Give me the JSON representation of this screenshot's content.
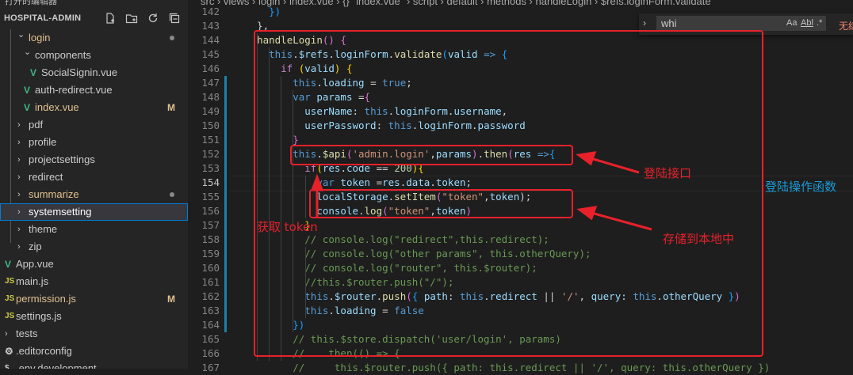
{
  "sidebar": {
    "cut_top_label": "打开的编辑器",
    "title": "HOSPITAL-ADMIN",
    "actions": [
      "new-file-icon",
      "new-folder-icon",
      "refresh-icon",
      "collapse-all-icon"
    ],
    "items": [
      {
        "label": "login",
        "kind": "folder-open",
        "depth": 1,
        "color": "#e2c08d",
        "status": "dot"
      },
      {
        "label": "components",
        "kind": "folder-open",
        "depth": 2,
        "color": "#cccccc",
        "status": ""
      },
      {
        "label": "SocialSignin.vue",
        "kind": "vue",
        "depth": 3,
        "color": "#cccccc",
        "status": ""
      },
      {
        "label": "auth-redirect.vue",
        "kind": "vue",
        "depth": 2,
        "color": "#cccccc",
        "status": ""
      },
      {
        "label": "index.vue",
        "kind": "vue",
        "depth": 2,
        "color": "#e2c08d",
        "status": "M"
      },
      {
        "label": "pdf",
        "kind": "folder",
        "depth": 1,
        "color": "#cccccc",
        "status": ""
      },
      {
        "label": "profile",
        "kind": "folder",
        "depth": 1,
        "color": "#cccccc",
        "status": ""
      },
      {
        "label": "projectsettings",
        "kind": "folder",
        "depth": 1,
        "color": "#cccccc",
        "status": ""
      },
      {
        "label": "redirect",
        "kind": "folder",
        "depth": 1,
        "color": "#cccccc",
        "status": ""
      },
      {
        "label": "summarize",
        "kind": "folder",
        "depth": 1,
        "color": "#e2c08d",
        "status": "dot"
      },
      {
        "label": "systemsetting",
        "kind": "folder",
        "depth": 1,
        "color": "#ffffff",
        "status": "",
        "selected": true
      },
      {
        "label": "theme",
        "kind": "folder",
        "depth": 1,
        "color": "#cccccc",
        "status": ""
      },
      {
        "label": "zip",
        "kind": "folder",
        "depth": 1,
        "color": "#cccccc",
        "status": ""
      },
      {
        "label": "App.vue",
        "kind": "vue",
        "depth": 0,
        "color": "#cccccc",
        "status": ""
      },
      {
        "label": "main.js",
        "kind": "js",
        "depth": 0,
        "color": "#cccccc",
        "status": ""
      },
      {
        "label": "permission.js",
        "kind": "js",
        "depth": 0,
        "color": "#e2c08d",
        "status": "M"
      },
      {
        "label": "settings.js",
        "kind": "js",
        "depth": 0,
        "color": "#cccccc",
        "status": ""
      },
      {
        "label": "tests",
        "kind": "folder",
        "depth": -1,
        "color": "#cccccc",
        "status": ""
      },
      {
        "label": ".editorconfig",
        "kind": "gear",
        "depth": -1,
        "color": "#cccccc",
        "status": ""
      },
      {
        "label": ".env.development",
        "kind": "env",
        "depth": -1,
        "color": "#cccccc",
        "status": ""
      }
    ]
  },
  "editor": {
    "breadcrumb": "src  ›  views  ›  login  ›  index.vue  ›  {} \"index.vue\"  ›  script  ›  default  ›  methods  ›  handleLogin  ›  $refs.loginForm.validate",
    "find": {
      "value": "whi",
      "opt_case": "Aa",
      "opt_word": "Abl",
      "opt_regex": ".*",
      "result": "无结果"
    },
    "current_line": 154,
    "lines": [
      {
        "n": 142,
        "toks": [
          [
            "    ",
            ""
          ],
          [
            "})",
            "t-br3"
          ]
        ]
      },
      {
        "n": 143,
        "toks": [
          [
            "  },",
            "t-op"
          ]
        ]
      },
      {
        "n": 144,
        "toks": [
          [
            "  ",
            ""
          ],
          [
            "handleLogin",
            "t-fn"
          ],
          [
            "() ",
            "t-br2"
          ],
          [
            "{",
            "t-br2"
          ]
        ]
      },
      {
        "n": 145,
        "toks": [
          [
            "    ",
            ""
          ],
          [
            "this",
            "t-kw"
          ],
          [
            ".",
            "t-op"
          ],
          [
            "$refs",
            "t-var"
          ],
          [
            ".",
            "t-op"
          ],
          [
            "loginForm",
            "t-var"
          ],
          [
            ".",
            "t-op"
          ],
          [
            "validate",
            "t-fn"
          ],
          [
            "(",
            "t-br3"
          ],
          [
            "valid",
            "t-var"
          ],
          [
            " => ",
            "t-kw"
          ],
          [
            "{",
            "t-br3"
          ]
        ]
      },
      {
        "n": 146,
        "toks": [
          [
            "      ",
            ""
          ],
          [
            "if",
            "t-ctrl"
          ],
          [
            " (",
            "t-br1"
          ],
          [
            "valid",
            "t-var"
          ],
          [
            ") ",
            "t-br1"
          ],
          [
            "{",
            "t-br1"
          ]
        ]
      },
      {
        "n": 147,
        "toks": [
          [
            "        ",
            ""
          ],
          [
            "this",
            "t-kw"
          ],
          [
            ".",
            "t-op"
          ],
          [
            "loading",
            "t-var"
          ],
          [
            " = ",
            "t-op"
          ],
          [
            "true",
            "t-kw"
          ],
          [
            ";",
            "t-op"
          ]
        ]
      },
      {
        "n": 148,
        "toks": [
          [
            "        ",
            ""
          ],
          [
            "var",
            "t-kw"
          ],
          [
            " ",
            ""
          ],
          [
            "params",
            "t-var"
          ],
          [
            " =",
            "t-op"
          ],
          [
            "{",
            "t-br2"
          ]
        ]
      },
      {
        "n": 149,
        "toks": [
          [
            "          ",
            ""
          ],
          [
            "userName",
            "t-var"
          ],
          [
            ": ",
            "t-op"
          ],
          [
            "this",
            "t-kw"
          ],
          [
            ".",
            "t-op"
          ],
          [
            "loginForm",
            "t-var"
          ],
          [
            ".",
            "t-op"
          ],
          [
            "username",
            "t-var"
          ],
          [
            ",",
            "t-op"
          ]
        ]
      },
      {
        "n": 150,
        "toks": [
          [
            "          ",
            ""
          ],
          [
            "userPassword",
            "t-var"
          ],
          [
            ": ",
            "t-op"
          ],
          [
            "this",
            "t-kw"
          ],
          [
            ".",
            "t-op"
          ],
          [
            "loginForm",
            "t-var"
          ],
          [
            ".",
            "t-op"
          ],
          [
            "password",
            "t-var"
          ]
        ]
      },
      {
        "n": 151,
        "toks": [
          [
            "        ",
            ""
          ],
          [
            "}",
            "t-br2"
          ]
        ]
      },
      {
        "n": 152,
        "toks": [
          [
            "        ",
            ""
          ],
          [
            "this",
            "t-kw"
          ],
          [
            ".",
            "t-op"
          ],
          [
            "$api",
            "t-fn"
          ],
          [
            "(",
            "t-br2"
          ],
          [
            "'admin.login'",
            "t-str"
          ],
          [
            ",",
            "t-op"
          ],
          [
            "params",
            "t-var"
          ],
          [
            ")",
            "t-br2"
          ],
          [
            ".",
            "t-op"
          ],
          [
            "then",
            "t-fn"
          ],
          [
            "(",
            "t-br2"
          ],
          [
            "res",
            "t-var"
          ],
          [
            " =>",
            "t-kw"
          ],
          [
            "{",
            "t-br3"
          ]
        ]
      },
      {
        "n": 153,
        "toks": [
          [
            "          ",
            ""
          ],
          [
            "if",
            "t-ctrl"
          ],
          [
            "(",
            "t-br1"
          ],
          [
            "res",
            "t-var"
          ],
          [
            ".",
            "t-op"
          ],
          [
            "code",
            "t-var"
          ],
          [
            " == ",
            "t-op"
          ],
          [
            "200",
            "t-num"
          ],
          [
            ")",
            "t-br1"
          ],
          [
            "{",
            "t-br1"
          ]
        ]
      },
      {
        "n": 154,
        "toks": [
          [
            "            ",
            ""
          ],
          [
            "var",
            "t-kw"
          ],
          [
            " ",
            ""
          ],
          [
            "token",
            "t-var"
          ],
          [
            " =",
            "t-op"
          ],
          [
            "res",
            "t-var"
          ],
          [
            ".",
            "t-op"
          ],
          [
            "data",
            "t-var"
          ],
          [
            ".",
            "t-op"
          ],
          [
            "token",
            "t-var"
          ],
          [
            ";",
            "t-op"
          ]
        ]
      },
      {
        "n": 155,
        "toks": [
          [
            "            ",
            ""
          ],
          [
            "localStorage",
            "t-var"
          ],
          [
            ".",
            "t-op"
          ],
          [
            "setItem",
            "t-fn"
          ],
          [
            "(",
            "t-br2"
          ],
          [
            "\"token\"",
            "t-str"
          ],
          [
            ",",
            "t-op"
          ],
          [
            "token",
            "t-var"
          ],
          [
            ");",
            "t-op"
          ]
        ]
      },
      {
        "n": 156,
        "toks": [
          [
            "            ",
            ""
          ],
          [
            "console",
            "t-var"
          ],
          [
            ".",
            "t-op"
          ],
          [
            "log",
            "t-fn"
          ],
          [
            "(",
            "t-br2"
          ],
          [
            "\"token\"",
            "t-str"
          ],
          [
            ",",
            "t-op"
          ],
          [
            "token",
            "t-var"
          ],
          [
            ")",
            "t-br2"
          ]
        ]
      },
      {
        "n": 157,
        "toks": [
          [
            "          ",
            ""
          ],
          [
            "}",
            "t-br1"
          ]
        ]
      },
      {
        "n": 158,
        "toks": [
          [
            "          ",
            ""
          ],
          [
            "// console.log(\"redirect\",this.redirect);",
            "t-cmt"
          ]
        ]
      },
      {
        "n": 159,
        "toks": [
          [
            "          ",
            ""
          ],
          [
            "// console.log(\"other params\", this.otherQuery);",
            "t-cmt"
          ]
        ]
      },
      {
        "n": 160,
        "toks": [
          [
            "          ",
            ""
          ],
          [
            "// console.log(\"router\", this.$router);",
            "t-cmt"
          ]
        ]
      },
      {
        "n": 161,
        "toks": [
          [
            "          ",
            ""
          ],
          [
            "//this.$router.push(\"/\");",
            "t-cmt"
          ]
        ]
      },
      {
        "n": 162,
        "toks": [
          [
            "          ",
            ""
          ],
          [
            "this",
            "t-kw"
          ],
          [
            ".",
            "t-op"
          ],
          [
            "$router",
            "t-var"
          ],
          [
            ".",
            "t-op"
          ],
          [
            "push",
            "t-fn"
          ],
          [
            "(",
            "t-br2"
          ],
          [
            "{ ",
            "t-br3"
          ],
          [
            "path",
            "t-var"
          ],
          [
            ": ",
            "t-op"
          ],
          [
            "this",
            "t-kw"
          ],
          [
            ".",
            "t-op"
          ],
          [
            "redirect",
            "t-var"
          ],
          [
            " || ",
            "t-op"
          ],
          [
            "'/'",
            "t-str"
          ],
          [
            ", ",
            "t-op"
          ],
          [
            "query",
            "t-var"
          ],
          [
            ": ",
            "t-op"
          ],
          [
            "this",
            "t-kw"
          ],
          [
            ".",
            "t-op"
          ],
          [
            "otherQuery",
            "t-var"
          ],
          [
            " }",
            "t-br3"
          ],
          [
            ")",
            "t-br2"
          ]
        ]
      },
      {
        "n": 163,
        "toks": [
          [
            "          ",
            ""
          ],
          [
            "this",
            "t-kw"
          ],
          [
            ".",
            "t-op"
          ],
          [
            "loading",
            "t-var"
          ],
          [
            " = ",
            "t-op"
          ],
          [
            "false",
            "t-kw"
          ]
        ]
      },
      {
        "n": 164,
        "toks": [
          [
            "        ",
            ""
          ],
          [
            "})",
            "t-br3"
          ]
        ]
      },
      {
        "n": 165,
        "toks": [
          [
            "        ",
            ""
          ],
          [
            "// this.$store.dispatch('user/login', params)",
            "t-cmt"
          ]
        ]
      },
      {
        "n": 166,
        "toks": [
          [
            "        ",
            ""
          ],
          [
            "//   .then(() => {",
            "t-cmt"
          ]
        ]
      },
      {
        "n": 167,
        "toks": [
          [
            "        ",
            ""
          ],
          [
            "//     this.$router.push({ path: this.redirect || '/', query: this.otherQuery })",
            "t-cmt"
          ]
        ]
      }
    ]
  },
  "annotations": {
    "login_api": "登陆接口",
    "get_token": "获取 token",
    "store_local": "存储到本地中",
    "handler": "登陆操作函数",
    "red": "#e8212b",
    "blue": "#1a9bd7"
  },
  "colors": {
    "accent": "#007fd4",
    "modified": "#e2c08d",
    "vue": "#41b883",
    "js": "#cbcb41"
  }
}
